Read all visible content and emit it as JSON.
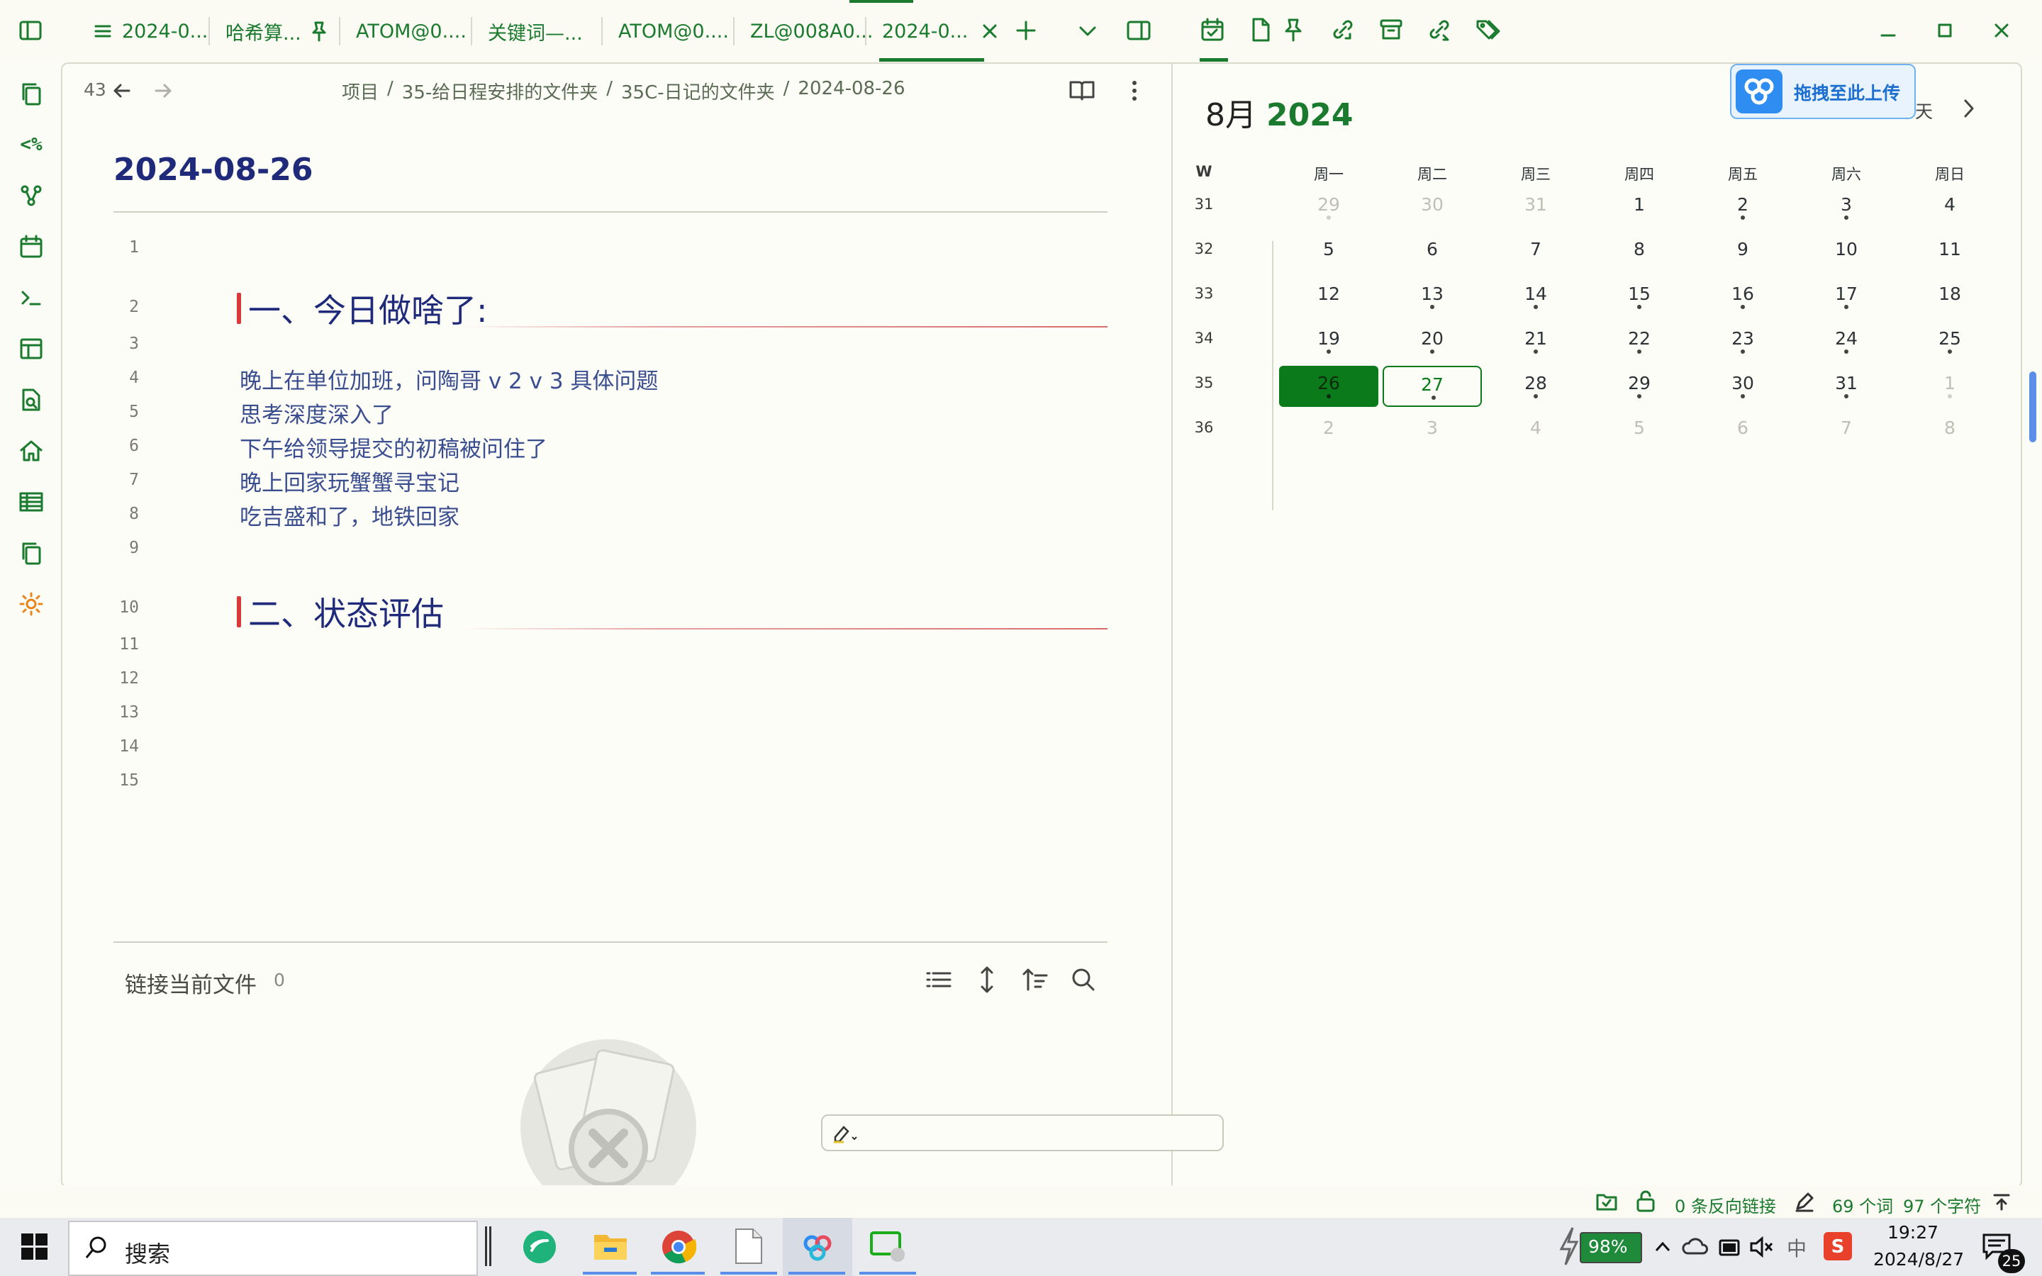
{
  "tabs": [
    {
      "label": "2024-0..."
    },
    {
      "label": "哈希算..."
    },
    {
      "label": "ATOM@0...."
    },
    {
      "label": "关键词—..."
    },
    {
      "label": "ATOM@0...."
    },
    {
      "label": "ZL@008A0..."
    },
    {
      "label": "2024-0..."
    }
  ],
  "editor": {
    "history_count": "43",
    "breadcrumb": [
      "项目",
      "35-给日程安排的文件夹",
      "35C-日记的文件夹",
      "2024-08-26"
    ],
    "title": "2024-08-26",
    "line_numbers": [
      "1",
      "2",
      "3",
      "4",
      "5",
      "6",
      "7",
      "8",
      "9",
      "10",
      "11",
      "12",
      "13",
      "14",
      "15"
    ],
    "heading1": "一、今日做啥了:",
    "lines": [
      "晚上在单位加班，问陶哥 v 2 v 3 具体问题",
      "思考深度深入了",
      "下午给领导提交的初稿被问住了",
      "晚上回家玩蟹蟹寻宝记",
      "吃吉盛和了，地铁回家"
    ],
    "heading2": "二、状态评估",
    "backlinks_label": "链接当前文件",
    "backlinks_count": "0"
  },
  "calendar": {
    "month": "8月",
    "year": "2024",
    "today_label": "今天",
    "upload_label": "拖拽至此上传",
    "week_header": "W",
    "weekdays": [
      "周一",
      "周二",
      "周三",
      "周四",
      "周五",
      "周六",
      "周日"
    ],
    "weeks": [
      {
        "w": "31",
        "days": [
          {
            "d": "29",
            "m": true,
            "dot": true
          },
          {
            "d": "30",
            "m": true,
            "dot": false
          },
          {
            "d": "31",
            "m": true,
            "dot": false
          },
          {
            "d": "1",
            "m": false,
            "dot": false
          },
          {
            "d": "2",
            "m": false,
            "dot": true
          },
          {
            "d": "3",
            "m": false,
            "dot": true
          },
          {
            "d": "4",
            "m": false,
            "dot": false
          }
        ]
      },
      {
        "w": "32",
        "days": [
          {
            "d": "5",
            "m": false,
            "dot": false
          },
          {
            "d": "6",
            "m": false,
            "dot": false
          },
          {
            "d": "7",
            "m": false,
            "dot": false
          },
          {
            "d": "8",
            "m": false,
            "dot": false
          },
          {
            "d": "9",
            "m": false,
            "dot": false
          },
          {
            "d": "10",
            "m": false,
            "dot": false
          },
          {
            "d": "11",
            "m": false,
            "dot": false
          }
        ]
      },
      {
        "w": "33",
        "days": [
          {
            "d": "12",
            "m": false,
            "dot": false
          },
          {
            "d": "13",
            "m": false,
            "dot": true
          },
          {
            "d": "14",
            "m": false,
            "dot": true
          },
          {
            "d": "15",
            "m": false,
            "dot": true
          },
          {
            "d": "16",
            "m": false,
            "dot": true
          },
          {
            "d": "17",
            "m": false,
            "dot": true
          },
          {
            "d": "18",
            "m": false,
            "dot": false
          }
        ]
      },
      {
        "w": "34",
        "days": [
          {
            "d": "19",
            "m": false,
            "dot": true
          },
          {
            "d": "20",
            "m": false,
            "dot": true
          },
          {
            "d": "21",
            "m": false,
            "dot": true
          },
          {
            "d": "22",
            "m": false,
            "dot": true
          },
          {
            "d": "23",
            "m": false,
            "dot": true
          },
          {
            "d": "24",
            "m": false,
            "dot": true
          },
          {
            "d": "25",
            "m": false,
            "dot": true
          }
        ]
      },
      {
        "w": "35",
        "days": [
          {
            "d": "26",
            "m": false,
            "dot": true,
            "active": true
          },
          {
            "d": "27",
            "m": false,
            "dot": true,
            "today": true
          },
          {
            "d": "28",
            "m": false,
            "dot": true
          },
          {
            "d": "29",
            "m": false,
            "dot": true
          },
          {
            "d": "30",
            "m": false,
            "dot": true
          },
          {
            "d": "31",
            "m": false,
            "dot": true
          },
          {
            "d": "1",
            "m": true,
            "dot": true
          }
        ]
      },
      {
        "w": "36",
        "days": [
          {
            "d": "2",
            "m": true,
            "dot": false
          },
          {
            "d": "3",
            "m": true,
            "dot": false
          },
          {
            "d": "4",
            "m": true,
            "dot": false
          },
          {
            "d": "5",
            "m": true,
            "dot": false
          },
          {
            "d": "6",
            "m": true,
            "dot": false
          },
          {
            "d": "7",
            "m": true,
            "dot": false
          },
          {
            "d": "8",
            "m": true,
            "dot": false
          }
        ]
      }
    ]
  },
  "statusbar": {
    "backlinks": "0 条反向链接",
    "words": "69 个词",
    "chars": "97 个字符"
  },
  "taskbar": {
    "search_placeholder": "搜索",
    "battery": "98%",
    "ime": "中",
    "time": "19:27",
    "date": "2024/8/27",
    "notifications": "25"
  },
  "colors": {
    "accent": "#1a7a2e",
    "heading": "#1f2a7a",
    "body_text": "#3a4d8f",
    "heading_marker": "#d83a3a",
    "calendar_active": "#0a7a1a"
  }
}
